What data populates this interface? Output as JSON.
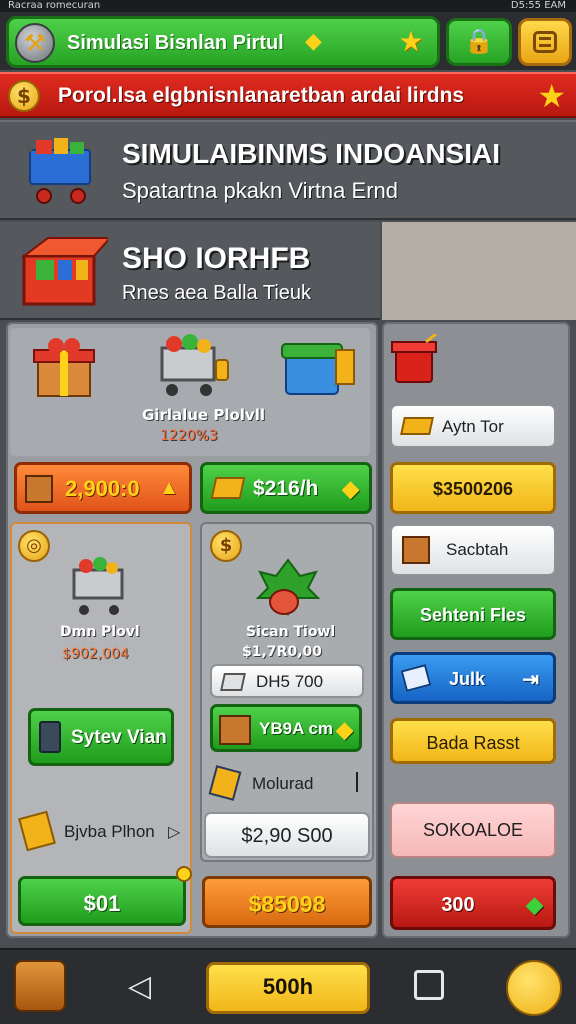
{
  "status_bar": {
    "left": "Racraa romecuran",
    "right": "D5:55 EAM"
  },
  "header": {
    "title": "Simulasi Bisnlan Pirtul"
  },
  "ticker": {
    "text": "Porol.lsa elgbnisnlanaretban ardai lirdns"
  },
  "hero": {
    "title": "SIMULAIBINMS INDOANSIAI",
    "subtitle": "Spatartna pkakn Virtna Ernd"
  },
  "store": {
    "title": "SHO IORHFB",
    "subtitle": "Rnes aea Balla Tieuk"
  },
  "products": {
    "name": "Girlalue Plolvll",
    "price": "1220%3"
  },
  "buy_buttons": {
    "orange": "2,900:0",
    "green": "$216/h"
  },
  "card_a": {
    "name": "Dmn Plovl",
    "price": "$902,004",
    "action": "Sytev Vian",
    "row_label": "Bjvba Plhon",
    "button": "$01"
  },
  "card_b": {
    "name": "Sican Tiowl",
    "price": "$1,7R0,00",
    "field": "DH5 700",
    "badge": "YB9A cm",
    "row_label": "Molurad",
    "input_value": "$2,90 S00",
    "button": "$85098"
  },
  "side": {
    "item1": "Aytn Tor",
    "value1": "$3500206",
    "item2": "Sacbtah",
    "green_btn": "Sehteni Fles",
    "blue_btn": "Julk",
    "yellow_btn": "Bada Rasst",
    "pink_btn": "SOKOALOE",
    "red_btn": "300"
  },
  "bottom": {
    "center": "500h"
  },
  "colors": {
    "primary_green": "#27a324",
    "ticker_red": "#c81d14",
    "accent_yellow": "#ffd21a"
  }
}
